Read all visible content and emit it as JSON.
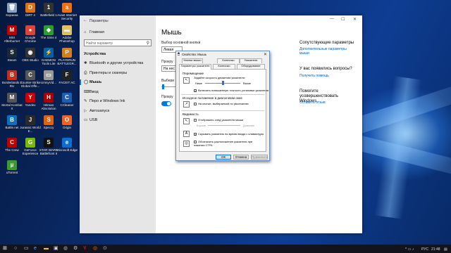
{
  "desktop_icons": [
    {
      "label": "Корзина",
      "color": "#8aa0c0",
      "glyph": "🗑"
    },
    {
      "label": "DiRT 4",
      "color": "#e07010",
      "glyph": "D"
    },
    {
      "label": "Battlefield 1",
      "color": "#333",
      "glyph": "1"
    },
    {
      "label": "Avast Internet Security",
      "color": "#f07010",
      "glyph": "a"
    },
    {
      "label": "MSI Afterburner",
      "color": "#b00",
      "glyph": "M"
    },
    {
      "label": "Google Chrome",
      "color": "#db4437",
      "glyph": "●"
    },
    {
      "label": "The Sims 4",
      "color": "#2a9d2a",
      "glyph": "◆"
    },
    {
      "label": "Adobe Photoshop",
      "color": "#e0c060",
      "glyph": "▬"
    },
    {
      "label": "Steam",
      "color": "#1b2838",
      "glyph": "S"
    },
    {
      "label": "OBS Studio",
      "color": "#333",
      "glyph": "◉"
    },
    {
      "label": "DAEMON Tools Lite",
      "color": "#0a5fa0",
      "glyph": "⚡"
    },
    {
      "label": "PLAYERUN BATTLEGR...",
      "color": "#d08020",
      "glyph": "P"
    },
    {
      "label": "Borderlands 2 RU",
      "color": "#c03020",
      "glyph": "B"
    },
    {
      "label": "Counter-Strike Global Offe...",
      "color": "#555",
      "glyph": "C"
    },
    {
      "label": "UmnyVid...",
      "color": "#999",
      "glyph": "▭"
    },
    {
      "label": "FACEIT AC",
      "color": "#222",
      "glyph": "F"
    },
    {
      "label": "Mortal Kombat X",
      "color": "#555",
      "glyph": "M"
    },
    {
      "label": "Yandex",
      "color": "#c00",
      "glyph": "Y"
    },
    {
      "label": "Hitman Absolution",
      "color": "#a00",
      "glyph": "H"
    },
    {
      "label": "CCleaner",
      "color": "#1a5fb4",
      "glyph": "C"
    },
    {
      "label": "Battle.net",
      "color": "#0a70c0",
      "glyph": "B"
    },
    {
      "label": "Jurassic World E...",
      "color": "#2a2a2a",
      "glyph": "J"
    },
    {
      "label": "Speccy",
      "color": "#e06010",
      "glyph": "S"
    },
    {
      "label": "Origin",
      "color": "#f06020",
      "glyph": "O"
    },
    {
      "label": "The Crew",
      "color": "#b00",
      "glyph": "C"
    },
    {
      "label": "GeForce Experience",
      "color": "#76b900",
      "glyph": "G"
    },
    {
      "label": "STAR WARS Battlefront II",
      "color": "#111",
      "glyph": "S"
    },
    {
      "label": "Microsoft Edge",
      "color": "#0a6fd0",
      "glyph": "e"
    },
    {
      "label": "uTorrent",
      "color": "#3b9b2e",
      "glyph": "µ"
    }
  ],
  "settings": {
    "window_title": "Параметры",
    "home": "Главная",
    "search_placeholder": "Найти параметр",
    "section": "Устройства",
    "nav": [
      {
        "icon": "✱",
        "label": "Bluetooth и другие устройства"
      },
      {
        "icon": "⎙",
        "label": "Принтеры и сканеры"
      },
      {
        "icon": "◯",
        "label": "Мышь"
      },
      {
        "icon": "⌨",
        "label": "Ввод"
      },
      {
        "icon": "✎",
        "label": "Перо и Windows Ink"
      },
      {
        "icon": "▷",
        "label": "Автозапуск"
      },
      {
        "icon": "▭",
        "label": "USB"
      }
    ],
    "page_title": "Мышь",
    "primary_button_label": "Выбор основной кнопки",
    "primary_button_value": "Левая",
    "scroll_label": "Прокру",
    "scroll_value": "На нес",
    "choose_label": "Выбери",
    "scroll_inactive_label": "Прокру",
    "related": {
      "title": "Сопутствующие параметры",
      "link": "Дополнительные параметры мыши"
    },
    "question": {
      "title": "У вас появились вопросы?",
      "link": "Получить помощь"
    },
    "improve": {
      "title": "Помогите усовершенствовать Windows",
      "link": "Оставить отзыв"
    }
  },
  "dialog": {
    "title": "Свойства: Мышь",
    "tabs_row1": [
      "Кнопки мыши",
      "Колесико",
      "Указатели"
    ],
    "tabs_row2": [
      "Параметры указателя",
      "Колесико",
      "Оборудование"
    ],
    "group_motion": "Перемещение",
    "speed_label": "Задайте скорость движения указателя:",
    "low": "Ниже",
    "high": "Выше",
    "precision": "Включить повышенную точность установки указателя",
    "group_default": "Исходное положение в диалоговом окне",
    "default_button": "На кнопке, выбираемой по умолчанию",
    "group_visibility": "Видимость",
    "trail": "Отображать след указателя мыши",
    "trail_short": "Короче",
    "trail_long": "Длиннее",
    "hide_typing": "Скрывать указатель во время ввода с клавиатуры",
    "show_location": "Обозначить расположение указателя при нажатии CTRL",
    "ok": "ОК",
    "cancel": "Отмена",
    "apply": "Применить"
  },
  "taskbar": {
    "lang": "РУС",
    "time": "21:48"
  }
}
